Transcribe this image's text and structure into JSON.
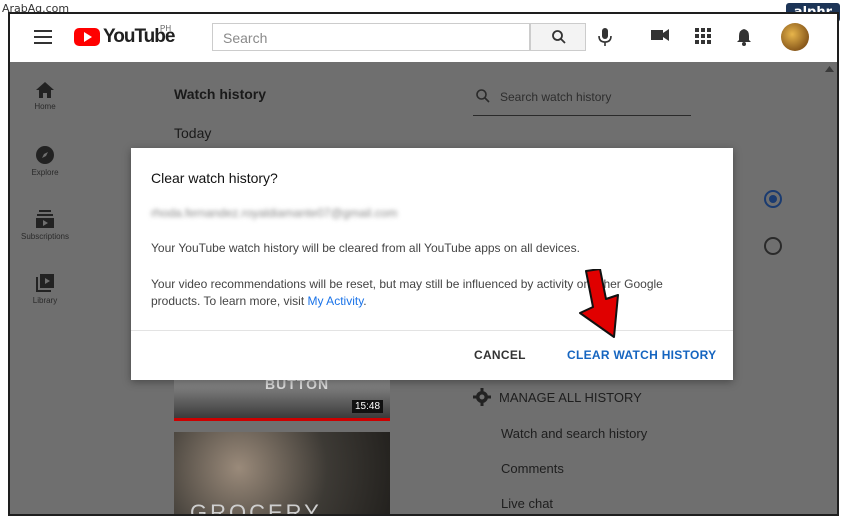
{
  "watermark": {
    "source_text": "ArabAq.com",
    "badge": "alphr"
  },
  "header": {
    "logo_text": "YouTube",
    "region": "PH",
    "search_placeholder": "Search",
    "accent": "#ff0000"
  },
  "sidebar": {
    "items": [
      {
        "label": "Home",
        "icon": "home-icon"
      },
      {
        "label": "Explore",
        "icon": "compass-icon"
      },
      {
        "label": "Subscriptions",
        "icon": "subscriptions-icon"
      },
      {
        "label": "Library",
        "icon": "library-icon"
      }
    ]
  },
  "main": {
    "title": "Watch history",
    "section": "Today",
    "video1": {
      "overlay_text": "BUTTON",
      "duration": "15:48"
    },
    "video2": {
      "overlay_text": "GROCERY"
    }
  },
  "right_panel": {
    "search_placeholder": "Search watch history",
    "manage_label": "MANAGE ALL HISTORY",
    "links": [
      "Watch and search history",
      "Comments",
      "Live chat"
    ]
  },
  "dialog": {
    "title": "Clear watch history?",
    "email": "rhoda.fernandez.royaldiamante07@gmail.com",
    "line1": "Your YouTube watch history will be cleared from all YouTube apps on all devices.",
    "line2_part1": "Your video recommendations will be reset, but may still be influenced by activity on other Google products. To learn more, visit ",
    "line2_link": "My Activity",
    "line2_end": ".",
    "cancel_label": "CANCEL",
    "confirm_label": "CLEAR WATCH HISTORY",
    "link_color": "#1a73e8",
    "confirm_color": "#1565c0"
  },
  "annotation": {
    "arrow_color": "#e00000"
  }
}
